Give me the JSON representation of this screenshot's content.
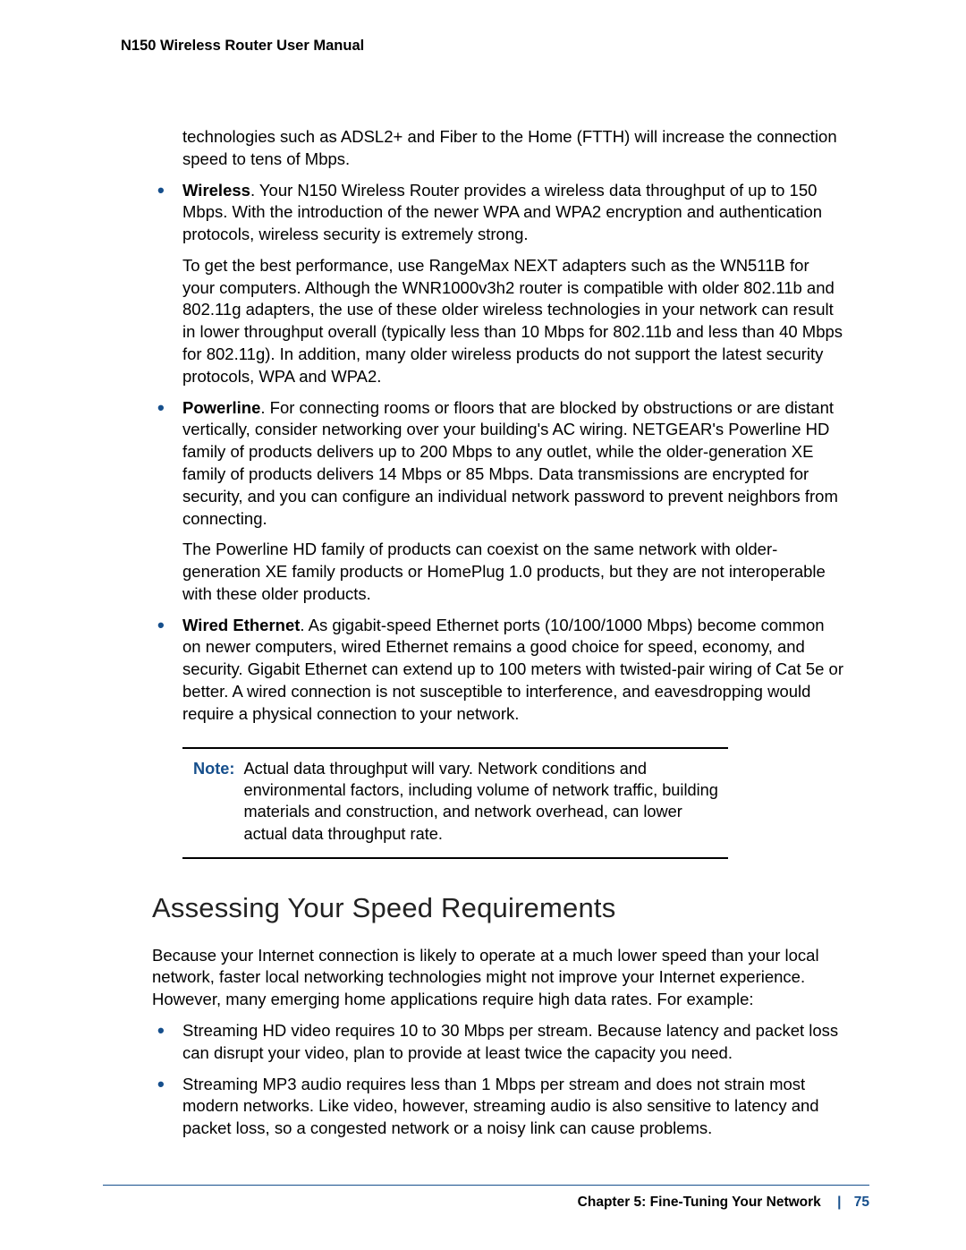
{
  "header": {
    "manual_title": "N150 Wireless Router User Manual"
  },
  "body": {
    "continued_paragraph": "technologies such as ADSL2+ and Fiber to the Home (FTTH) will increase the connection speed to tens of Mbps.",
    "bullets1": [
      {
        "lead": "Wireless",
        "text": ". Your N150 Wireless Router provides a wireless data throughput of up to 150 Mbps. With the introduction of the newer WPA and WPA2 encryption and authentication protocols, wireless security is extremely strong.",
        "paras": [
          "To get the best performance, use RangeMax NEXT adapters such as the WN511B for your computers. Although the WNR1000v3h2 router is compatible with older 802.11b and 802.11g adapters, the use of these older wireless technologies in your network can result in lower throughput overall (typically less than 10 Mbps for 802.11b and less than 40 Mbps for 802.11g). In addition, many older wireless products do not support the latest security protocols, WPA and WPA2."
        ]
      },
      {
        "lead": "Powerline",
        "text": ". For connecting rooms or floors that are blocked by obstructions or are distant vertically, consider networking over your building's AC wiring. NETGEAR's Powerline HD family of products delivers up to 200 Mbps to any outlet, while the older-generation XE family of products delivers 14 Mbps or 85 Mbps. Data transmissions are encrypted for security, and you can configure an individual network password to prevent neighbors from connecting.",
        "paras": [
          "The Powerline HD family of products can coexist on the same network with older-generation XE family products or HomePlug 1.0 products, but they are not interoperable with these older products."
        ]
      },
      {
        "lead": "Wired Ethernet",
        "text": ". As gigabit-speed Ethernet ports (10/100/1000 Mbps) become common on newer computers, wired Ethernet remains a good choice for speed, economy, and security. Gigabit Ethernet can extend up to 100 meters with twisted-pair wiring of Cat 5e or better. A wired connection is not susceptible to interference, and eavesdropping would require a physical connection to your network.",
        "paras": []
      }
    ],
    "note": {
      "label": "Note:",
      "text": "Actual data throughput will vary. Network conditions and environmental factors, including volume of network traffic, building materials and construction, and network overhead, can lower actual data throughput rate."
    },
    "section_heading": "Assessing Your Speed Requirements",
    "section_intro": "Because your Internet connection is likely to operate at a much lower speed than your local network, faster local networking technologies might not improve your Internet experience. However, many emerging home applications require high data rates. For example:",
    "bullets2": [
      "Streaming HD video requires 10 to 30 Mbps per stream. Because latency and packet loss can disrupt your video, plan to provide at least twice the capacity you need.",
      "Streaming MP3 audio requires less than 1 Mbps per stream and does not strain most modern networks. Like video, however, streaming audio is also sensitive to latency and packet loss, so a congested network or a noisy link can cause problems."
    ]
  },
  "footer": {
    "chapter_label": "Chapter 5:  Fine-Tuning Your Network",
    "separator": "|",
    "page_number": "75"
  }
}
